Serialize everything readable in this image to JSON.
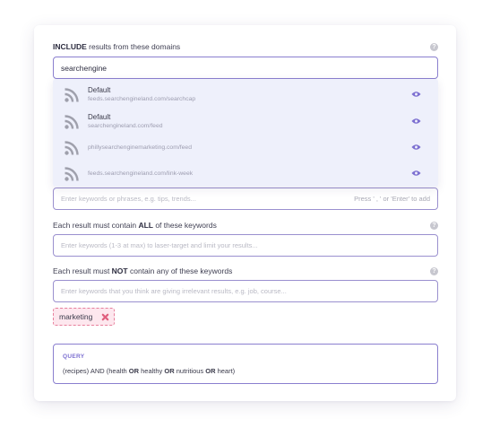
{
  "include": {
    "label_bold": "INCLUDE",
    "label_rest": " results from these domains",
    "input_value": "searchengine"
  },
  "suggestions": [
    {
      "name": "Default",
      "url": "feeds.searchengineland.com/searchcap"
    },
    {
      "name": "Default",
      "url": "searchengineland.com/feed"
    },
    {
      "name": "",
      "url": "phillysearchenginemarketing.com/feed"
    },
    {
      "name": "",
      "url": "feeds.searchengineland.com/link-week"
    }
  ],
  "any_keywords": {
    "placeholder": "Enter keywords or phrases, e.g. tips, trends...",
    "hint": "Press ' , ' or 'Enter' to add"
  },
  "all_keywords": {
    "label_pre": "Each result must contain ",
    "label_bold": "ALL",
    "label_post": " of these keywords",
    "placeholder": "Enter keywords (1-3 at max) to laser-target and limit your results..."
  },
  "not_keywords": {
    "label_pre": "Each result must ",
    "label_bold": "NOT",
    "label_post": " contain any of these keywords",
    "placeholder": "Enter keywords that you think are giving irrelevant results, e.g. job, course..."
  },
  "excluded_tag": "marketing",
  "query": {
    "title": "QUERY",
    "p1": "(recipes) AND (health ",
    "or1": "OR",
    "p2": " healthy ",
    "or2": "OR",
    "p3": " nutritious ",
    "or3": "OR",
    "p4": " heart)"
  },
  "icons": {
    "help": "?",
    "rss": "rss-feed-icon",
    "eye": "eye-icon",
    "remove": "close-icon"
  },
  "colors": {
    "accent": "#7c6fd1",
    "field_border": "#9a90cf",
    "dropdown_bg": "#eef0fb",
    "tag_bg": "#fde7ee",
    "tag_border": "#e7809c",
    "tag_x": "#e0607f"
  }
}
